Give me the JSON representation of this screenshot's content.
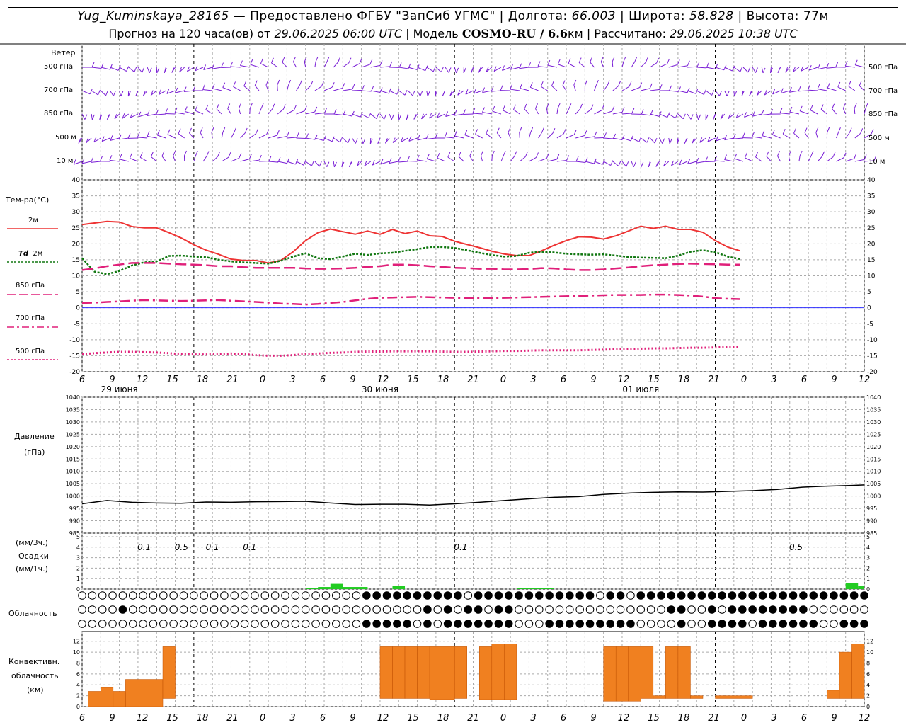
{
  "header": {
    "station": "Yug_Kuminskaya_28165",
    "provider": "— Предоставлено ФГБУ \"ЗапСиб УГМС\"",
    "lon_label": "| Долгота:",
    "lon": "66.003",
    "lat_label": "| Широта:",
    "lat": "58.828",
    "alt_label": "| Высота: 77м",
    "forecast_label": "Прогноз на 120 часа(ов) от",
    "forecast_start": "29.06.2025 06:00 UTC",
    "model_label": "| Модель",
    "model": "COSMO-RU / 6.6",
    "model_unit": "км",
    "calc_label": "| Рассчитано:",
    "calc_time": "29.06.2025 10:38 UTC"
  },
  "wind_panel": {
    "title": "Ветер",
    "levels": [
      "500 гПа",
      "700 гПа",
      "850 гПа",
      "500 м",
      "10 м"
    ],
    "barb_color": "#7a1fd6"
  },
  "temp_panel": {
    "title": "Тем-ра(°С)",
    "legend": [
      {
        "label": "2м",
        "color": "#ee3333",
        "dash": "solid"
      },
      {
        "label_it": "Td",
        "label": "2м",
        "color": "#117711",
        "dash": "dotted"
      },
      {
        "label": "850 гПа",
        "color": "#e0207a",
        "dash": "dashed"
      },
      {
        "label": "700 гПа",
        "color": "#e0207a",
        "dash": "dashdot"
      },
      {
        "label": "500 гПа",
        "color": "#e0207a",
        "dash": "dotted"
      }
    ]
  },
  "pressure_panel": {
    "title": "Давление",
    "unit": "(гПа)"
  },
  "precip_panel": {
    "unit_3h": "(мм/3ч.)",
    "title": "Осадки",
    "unit_1h": "(мм/1ч.)",
    "labels": [
      {
        "x": 5,
        "text": "0.1"
      },
      {
        "x": 8,
        "text": "0.5"
      },
      {
        "x": 10.5,
        "text": "0.1"
      },
      {
        "x": 13.5,
        "text": "0.1"
      },
      {
        "x": 30.5,
        "text": "0.1"
      },
      {
        "x": 57.5,
        "text": "0.5"
      }
    ]
  },
  "cloud_panel": {
    "title": "Облачность"
  },
  "conv_panel": {
    "title1": "Конвективн.",
    "title2": "облачность",
    "unit": "(км)"
  },
  "dates": [
    "29 июня",
    "30 июня",
    "01 июля"
  ],
  "hour_ticks": [
    "6",
    "9",
    "12",
    "15",
    "18",
    "21",
    "0",
    "3",
    "6",
    "9",
    "12",
    "15",
    "18",
    "21",
    "0",
    "3",
    "6",
    "9",
    "12",
    "15",
    "18",
    "21",
    "0",
    "3",
    "6",
    "9",
    "12"
  ],
  "chart_data": [
    {
      "type": "line",
      "name": "Температура",
      "xlabel": "",
      "ylabel": "Тем-ра(°С)",
      "ylim": [
        -20,
        40
      ],
      "x_hours_from_start": [
        0,
        2,
        4,
        6,
        8,
        10,
        12,
        14,
        16,
        18,
        20,
        22,
        24,
        26,
        28,
        30,
        32,
        34,
        36,
        38,
        40,
        42,
        44,
        46,
        48,
        50,
        52,
        54,
        56,
        58,
        60,
        62,
        64,
        66,
        68,
        70,
        72,
        74,
        76,
        78,
        80,
        82,
        84,
        86,
        88,
        90,
        92,
        94,
        96,
        98,
        100,
        102,
        104,
        106
      ],
      "series": [
        {
          "name": "2м",
          "values": [
            26,
            26.5,
            27,
            26.8,
            25.4,
            25,
            25,
            23.5,
            21.8,
            19.7,
            18,
            16.7,
            15.2,
            14.8,
            14.8,
            14,
            14.8,
            17.5,
            21,
            23.5,
            24.6,
            23.8,
            23,
            24,
            23,
            24.5,
            23.2,
            24,
            22.5,
            22.3,
            20.8,
            19.8,
            18.8,
            17.7,
            16.8,
            16.3,
            16.3,
            17.8,
            19.5,
            21,
            22.2,
            22.1,
            21.5,
            22.5,
            24,
            25.5,
            24.8,
            25.5,
            24.5,
            24.5,
            23.6,
            21,
            19,
            17.8
          ]
        },
        {
          "name": "Td 2м",
          "values": [
            15.5,
            11.3,
            10.5,
            11.5,
            13.2,
            14.2,
            14.5,
            16.2,
            16.3,
            16,
            15.8,
            15,
            14.5,
            14.2,
            14,
            13.8,
            14.7,
            16,
            17,
            15.5,
            15.2,
            16,
            16.9,
            16.5,
            17,
            17.2,
            17.8,
            18.3,
            19,
            19,
            18.7,
            18,
            17.2,
            16.5,
            16,
            16.2,
            17.2,
            17.5,
            17.3,
            16.9,
            16.7,
            16.6,
            16.7,
            16.3,
            15.9,
            15.7,
            15.6,
            15.5,
            16.3,
            17.5,
            18,
            17.4,
            16,
            15.2
          ]
        },
        {
          "name": "850 гПа",
          "values": [
            11.8,
            12.3,
            13,
            13.5,
            14,
            14,
            14,
            13.8,
            13.6,
            13.5,
            13.3,
            13,
            13,
            12.7,
            12.5,
            12.5,
            12.5,
            12.5,
            12.3,
            12.2,
            12.2,
            12.3,
            12.5,
            12.8,
            13,
            13.5,
            13.5,
            13.3,
            13,
            12.8,
            12.5,
            12.4,
            12.2,
            12.2,
            12,
            12,
            12.1,
            12.4,
            12.3,
            12,
            11.8,
            11.8,
            12,
            12.3,
            12.6,
            13,
            13.3,
            13.5,
            13.7,
            13.8,
            13.7,
            13.6,
            13.5,
            13.5
          ]
        },
        {
          "name": "700 гПа",
          "values": [
            1.5,
            1.6,
            1.8,
            2,
            2.2,
            2.4,
            2.3,
            2.2,
            2.1,
            2.2,
            2.3,
            2.4,
            2.2,
            2,
            1.8,
            1.6,
            1.3,
            1.2,
            1,
            1.2,
            1.5,
            1.8,
            2.3,
            2.8,
            3.1,
            3.2,
            3.3,
            3.4,
            3.3,
            3.2,
            3.1,
            3,
            3,
            3,
            3.1,
            3.2,
            3.3,
            3.4,
            3.5,
            3.6,
            3.7,
            3.8,
            3.9,
            4,
            4,
            4,
            4.1,
            4.1,
            4,
            3.8,
            3.5,
            3,
            2.8,
            2.7
          ]
        },
        {
          "name": "500 гПа",
          "values": [
            -14.5,
            -14.2,
            -14,
            -13.8,
            -13.8,
            -13.9,
            -14,
            -14.2,
            -14.5,
            -14.6,
            -14.6,
            -14.5,
            -14.3,
            -14.5,
            -14.8,
            -15,
            -15,
            -14.8,
            -14.5,
            -14.3,
            -14.1,
            -14,
            -13.8,
            -13.7,
            -13.7,
            -13.6,
            -13.6,
            -13.6,
            -13.6,
            -13.7,
            -13.8,
            -13.8,
            -13.7,
            -13.6,
            -13.5,
            -13.5,
            -13.4,
            -13.3,
            -13.3,
            -13.3,
            -13.3,
            -13.2,
            -13.1,
            -13,
            -12.9,
            -12.8,
            -12.7,
            -12.7,
            -12.6,
            -12.5,
            -12.5,
            -12.4,
            -12.3,
            -12.3
          ]
        }
      ]
    },
    {
      "type": "line",
      "name": "Давление",
      "ylabel": "Давление (гПа)",
      "ylim": [
        985,
        1040
      ],
      "x_hours_from_start": [
        0,
        4,
        8,
        12,
        16,
        20,
        24,
        28,
        32,
        36,
        40,
        44,
        48,
        52,
        56,
        60,
        64,
        68,
        72,
        76,
        80,
        84,
        88,
        92,
        96,
        100,
        104,
        108,
        112,
        116,
        120,
        124,
        126
      ],
      "series": [
        {
          "name": "Давление",
          "values": [
            996.9,
            998.2,
            997.5,
            997.2,
            997.1,
            997.6,
            997.5,
            997.7,
            997.8,
            997.9,
            997.2,
            996.6,
            996.7,
            996.7,
            996.4,
            996.9,
            997.5,
            998.2,
            998.9,
            999.5,
            999.8,
            1000.7,
            1001.2,
            1001.5,
            1001.7,
            1001.6,
            1001.9,
            1002.2,
            1002.7,
            1003.6,
            1004,
            1004.3,
            1004.5
          ]
        }
      ]
    },
    {
      "type": "bar",
      "name": "Осадки",
      "ylabel": "Осадки (мм/1ч.)",
      "ylim": [
        0,
        5
      ],
      "x_hours_from_start": [
        30,
        33,
        36,
        39,
        42,
        45,
        48,
        51,
        54,
        57,
        60,
        63,
        66,
        69,
        72,
        75,
        78,
        81,
        84,
        87,
        90,
        93,
        96,
        99,
        102,
        105,
        108,
        111,
        114,
        117,
        120,
        123,
        126
      ],
      "values": [
        0,
        0,
        0,
        0,
        0,
        0,
        0,
        0,
        0,
        0,
        0,
        0,
        0,
        0,
        0,
        0,
        0,
        0,
        0,
        0,
        0,
        0,
        0,
        0,
        0,
        0,
        0,
        0,
        0,
        0,
        0,
        0,
        0
      ]
    },
    {
      "type": "bar",
      "name": "Конвективная облачность",
      "ylabel": "Конвективн. облачность (км)",
      "ylim": [
        0,
        13
      ],
      "bars": [
        {
          "x0": 1,
          "x1": 3,
          "lo": 0,
          "hi": 2.8
        },
        {
          "x0": 3,
          "x1": 5,
          "lo": 0,
          "hi": 3.5
        },
        {
          "x0": 5,
          "x1": 7,
          "lo": 0,
          "hi": 2.8
        },
        {
          "x0": 7,
          "x1": 13,
          "lo": 0,
          "hi": 5.0
        },
        {
          "x0": 13,
          "x1": 14,
          "lo": 1.5,
          "hi": 11.0
        }
      ]
    }
  ]
}
